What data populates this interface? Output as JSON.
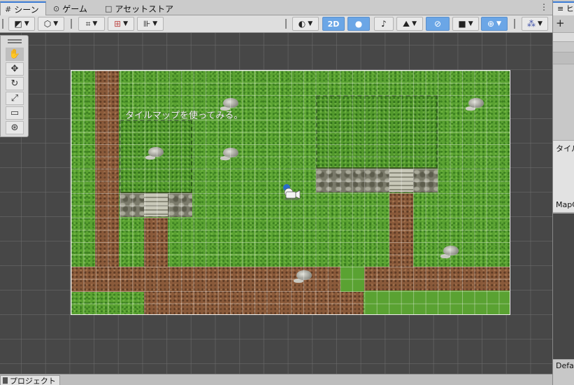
{
  "tabs": [
    {
      "icon": "grid-icon",
      "glyph": "#",
      "label": "シーン",
      "active": true
    },
    {
      "icon": "gamepad-icon",
      "glyph": "⊙",
      "label": "ゲーム",
      "active": false
    },
    {
      "icon": "store-icon",
      "glyph": "🔒",
      "label": "アセットストア",
      "active": false
    }
  ],
  "tab_menu": "⋮",
  "toolbar": {
    "draw_mode_glyph": "◩",
    "shading_glyph": "⬡",
    "move_snap_glyph": "⌗",
    "increment_snap_glyph": "⊞",
    "ruler_glyph": "⊪",
    "gizmo_sphere_glyph": "◐",
    "mode_2d": "2D",
    "light_glyph": "💡",
    "audio_glyph": "🔇",
    "effects_glyph": "⛰",
    "visibility_glyph": "⊘",
    "camera_glyph": "■",
    "gizmos_glyph": "⊕",
    "layers_glyph": "⁂",
    "dropdown_glyph": "▼"
  },
  "scene": {
    "caption": "タイルマップを使ってみる。"
  },
  "palette": {
    "tools": [
      {
        "name": "hand-tool",
        "glyph": "✋"
      },
      {
        "name": "move-tool",
        "glyph": "✥"
      },
      {
        "name": "rotate-tool",
        "glyph": "↻"
      },
      {
        "name": "scale-tool",
        "glyph": "⤢"
      },
      {
        "name": "rect-tool",
        "glyph": "▭"
      },
      {
        "name": "transform-tool",
        "glyph": "⊛"
      }
    ]
  },
  "right_panel": {
    "tab_label": "ヒ",
    "add_glyph": "+",
    "inspector_label": "タイル",
    "map_label": "MapC",
    "default_label": "Defa"
  },
  "bottom": {
    "project_tab": "プロジェクト",
    "folder_glyph": "▇"
  },
  "colors": {
    "accent": "#3a7bd5",
    "scene_bg": "#474747",
    "grass": "#5aa232",
    "dirt": "#8a5a3a"
  }
}
